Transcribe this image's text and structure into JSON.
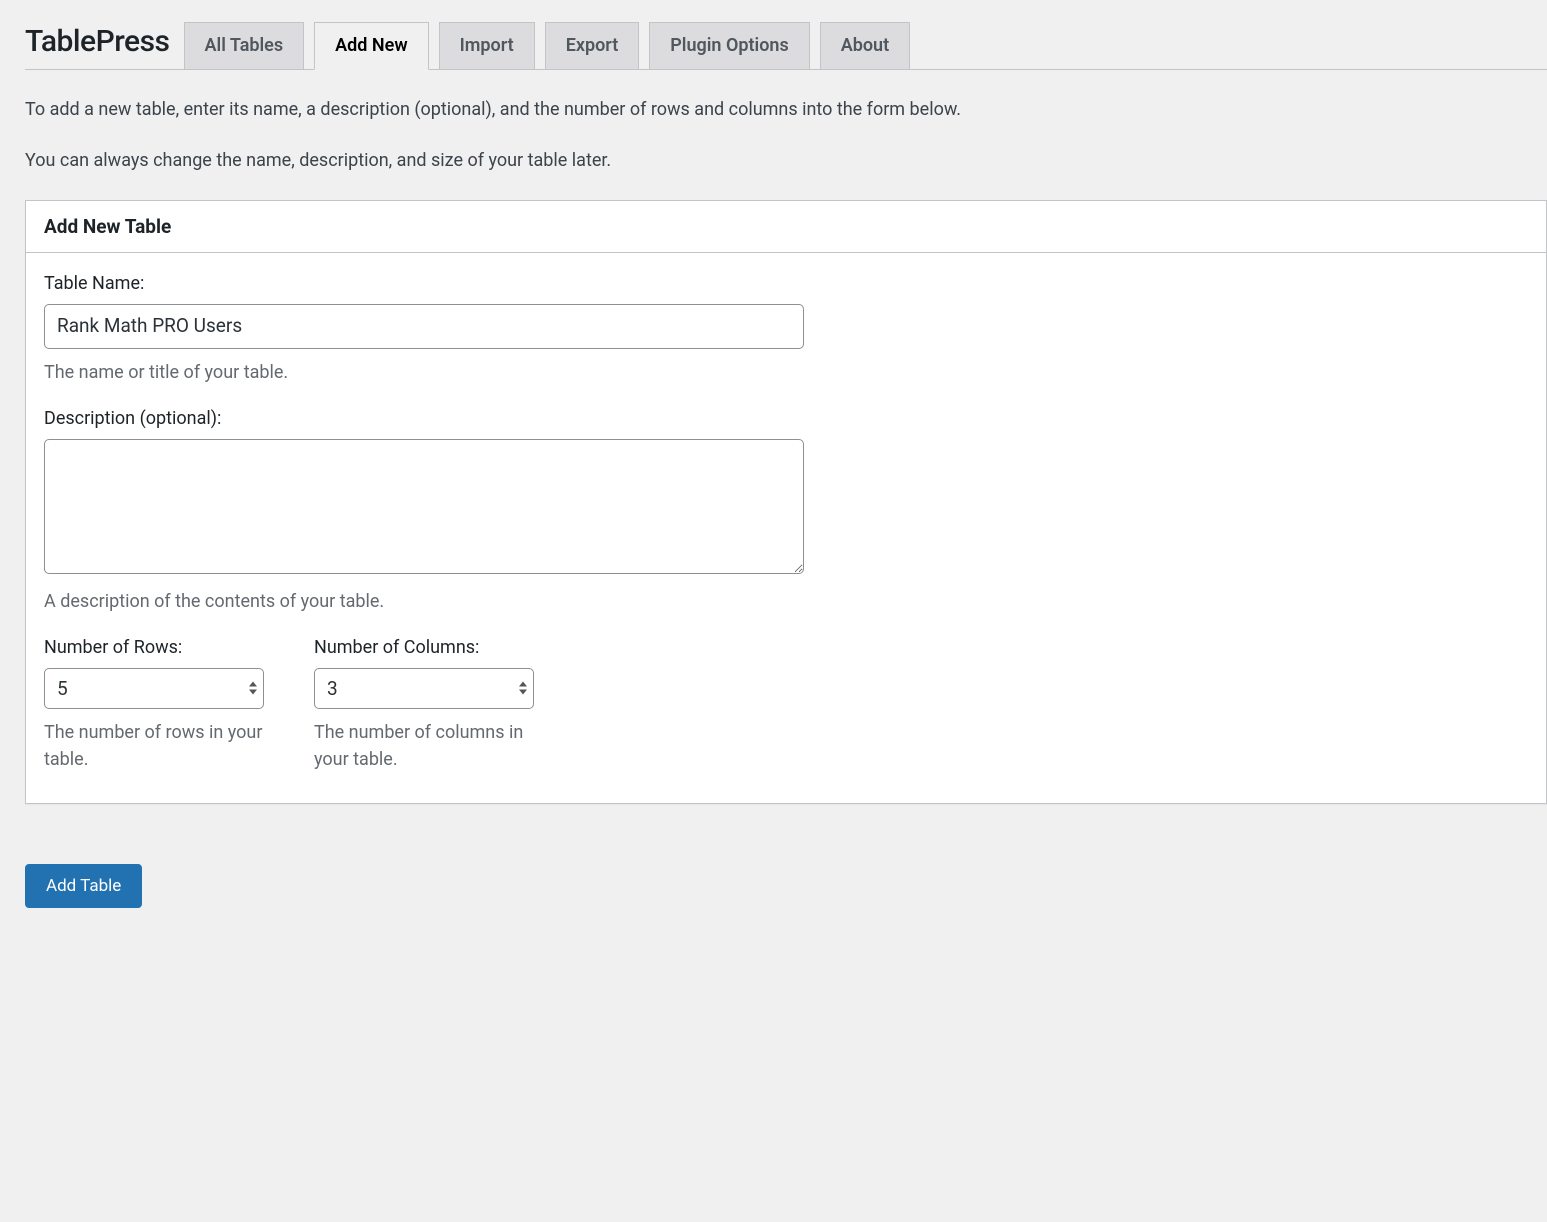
{
  "page_title": "TablePress",
  "tabs": [
    {
      "label": "All Tables",
      "active": false
    },
    {
      "label": "Add New",
      "active": true
    },
    {
      "label": "Import",
      "active": false
    },
    {
      "label": "Export",
      "active": false
    },
    {
      "label": "Plugin Options",
      "active": false
    },
    {
      "label": "About",
      "active": false
    }
  ],
  "intro": {
    "line1": "To add a new table, enter its name, a description (optional), and the number of rows and columns into the form below.",
    "line2": "You can always change the name, description, and size of your table later."
  },
  "panel": {
    "heading": "Add New Table",
    "table_name": {
      "label": "Table Name:",
      "value": "Rank Math PRO Users",
      "help": "The name or title of your table."
    },
    "description": {
      "label": "Description (optional):",
      "value": "",
      "help": "A description of the contents of your table."
    },
    "rows": {
      "label": "Number of Rows:",
      "value": "5",
      "help": "The number of rows in your table."
    },
    "cols": {
      "label": "Number of Columns:",
      "value": "3",
      "help": "The number of columns in your table."
    }
  },
  "submit_label": "Add Table"
}
